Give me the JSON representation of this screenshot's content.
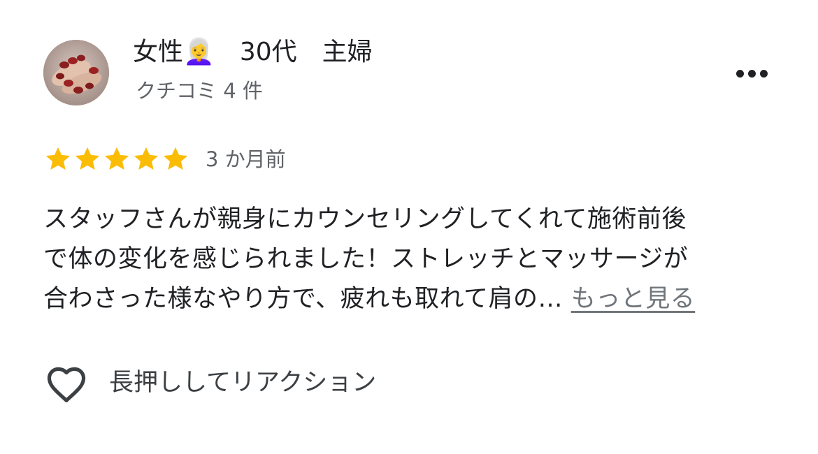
{
  "reviewer": {
    "name": "女性👩‍🦳　30代　主婦",
    "review_count": "クチコミ 4 件"
  },
  "menu": {
    "icon": "more-horizontal-icon"
  },
  "review": {
    "rating": 5,
    "rating_max": 5,
    "star_color": "#fbbc04",
    "date": "3 か月前",
    "lines": [
      "スタッフさんが親身にカウンセリングしてくれて施術前後",
      "で体の変化を感じられました！ストレッチとマッサージが",
      "合わさった様なやり方で、疲れも取れて肩の… "
    ],
    "more_label": "もっと見る"
  },
  "reaction": {
    "icon": "heart-outline-icon",
    "label": "長押ししてリアクション"
  }
}
